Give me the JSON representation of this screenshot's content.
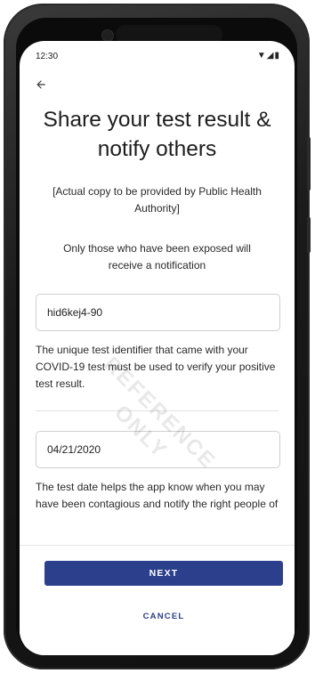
{
  "status_bar": {
    "time": "12:30",
    "icons": "▼◢▮"
  },
  "back_icon": "arrow-back-icon",
  "title": "Share your test result & notify others",
  "copy_note": "[Actual copy to be provided by Public Health Authority]",
  "notice": "Only those who have been exposed will receive a notification",
  "test_id_field": {
    "value": "hid6kej4-90"
  },
  "test_id_help": "The unique test identifier that came with your COVID-19 test must be used to verify your positive test result.",
  "test_date_field": {
    "value": "04/21/2020"
  },
  "test_date_help": "The test date helps the app know when you may have been contagious and notify the right people of possible exposure.",
  "buttons": {
    "next": "NEXT",
    "cancel": "CANCEL"
  },
  "watermark": {
    "line1": "REFERENCE",
    "line2": "ONLY"
  },
  "colors": {
    "primary": "#2c3f8c",
    "text": "#2a2a2a"
  }
}
